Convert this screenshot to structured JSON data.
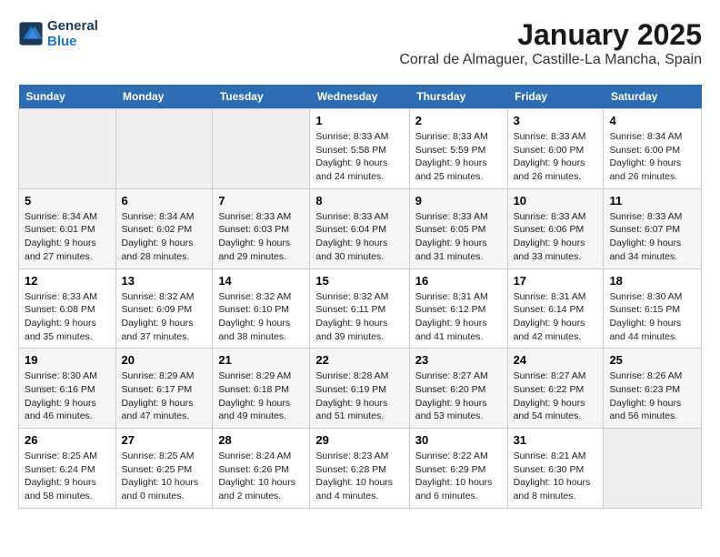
{
  "header": {
    "logo_line1": "General",
    "logo_line2": "Blue",
    "title": "January 2025",
    "subtitle": "Corral de Almaguer, Castille-La Mancha, Spain"
  },
  "columns": [
    "Sunday",
    "Monday",
    "Tuesday",
    "Wednesday",
    "Thursday",
    "Friday",
    "Saturday"
  ],
  "weeks": [
    [
      {
        "day": "",
        "empty": true
      },
      {
        "day": "",
        "empty": true
      },
      {
        "day": "",
        "empty": true
      },
      {
        "day": "1",
        "info": "Sunrise: 8:33 AM\nSunset: 5:58 PM\nDaylight: 9 hours and 24 minutes."
      },
      {
        "day": "2",
        "info": "Sunrise: 8:33 AM\nSunset: 5:59 PM\nDaylight: 9 hours and 25 minutes."
      },
      {
        "day": "3",
        "info": "Sunrise: 8:33 AM\nSunset: 6:00 PM\nDaylight: 9 hours and 26 minutes."
      },
      {
        "day": "4",
        "info": "Sunrise: 8:34 AM\nSunset: 6:00 PM\nDaylight: 9 hours and 26 minutes."
      }
    ],
    [
      {
        "day": "5",
        "info": "Sunrise: 8:34 AM\nSunset: 6:01 PM\nDaylight: 9 hours and 27 minutes."
      },
      {
        "day": "6",
        "info": "Sunrise: 8:34 AM\nSunset: 6:02 PM\nDaylight: 9 hours and 28 minutes."
      },
      {
        "day": "7",
        "info": "Sunrise: 8:33 AM\nSunset: 6:03 PM\nDaylight: 9 hours and 29 minutes."
      },
      {
        "day": "8",
        "info": "Sunrise: 8:33 AM\nSunset: 6:04 PM\nDaylight: 9 hours and 30 minutes."
      },
      {
        "day": "9",
        "info": "Sunrise: 8:33 AM\nSunset: 6:05 PM\nDaylight: 9 hours and 31 minutes."
      },
      {
        "day": "10",
        "info": "Sunrise: 8:33 AM\nSunset: 6:06 PM\nDaylight: 9 hours and 33 minutes."
      },
      {
        "day": "11",
        "info": "Sunrise: 8:33 AM\nSunset: 6:07 PM\nDaylight: 9 hours and 34 minutes."
      }
    ],
    [
      {
        "day": "12",
        "info": "Sunrise: 8:33 AM\nSunset: 6:08 PM\nDaylight: 9 hours and 35 minutes."
      },
      {
        "day": "13",
        "info": "Sunrise: 8:32 AM\nSunset: 6:09 PM\nDaylight: 9 hours and 37 minutes."
      },
      {
        "day": "14",
        "info": "Sunrise: 8:32 AM\nSunset: 6:10 PM\nDaylight: 9 hours and 38 minutes."
      },
      {
        "day": "15",
        "info": "Sunrise: 8:32 AM\nSunset: 6:11 PM\nDaylight: 9 hours and 39 minutes."
      },
      {
        "day": "16",
        "info": "Sunrise: 8:31 AM\nSunset: 6:12 PM\nDaylight: 9 hours and 41 minutes."
      },
      {
        "day": "17",
        "info": "Sunrise: 8:31 AM\nSunset: 6:14 PM\nDaylight: 9 hours and 42 minutes."
      },
      {
        "day": "18",
        "info": "Sunrise: 8:30 AM\nSunset: 6:15 PM\nDaylight: 9 hours and 44 minutes."
      }
    ],
    [
      {
        "day": "19",
        "info": "Sunrise: 8:30 AM\nSunset: 6:16 PM\nDaylight: 9 hours and 46 minutes."
      },
      {
        "day": "20",
        "info": "Sunrise: 8:29 AM\nSunset: 6:17 PM\nDaylight: 9 hours and 47 minutes."
      },
      {
        "day": "21",
        "info": "Sunrise: 8:29 AM\nSunset: 6:18 PM\nDaylight: 9 hours and 49 minutes."
      },
      {
        "day": "22",
        "info": "Sunrise: 8:28 AM\nSunset: 6:19 PM\nDaylight: 9 hours and 51 minutes."
      },
      {
        "day": "23",
        "info": "Sunrise: 8:27 AM\nSunset: 6:20 PM\nDaylight: 9 hours and 53 minutes."
      },
      {
        "day": "24",
        "info": "Sunrise: 8:27 AM\nSunset: 6:22 PM\nDaylight: 9 hours and 54 minutes."
      },
      {
        "day": "25",
        "info": "Sunrise: 8:26 AM\nSunset: 6:23 PM\nDaylight: 9 hours and 56 minutes."
      }
    ],
    [
      {
        "day": "26",
        "info": "Sunrise: 8:25 AM\nSunset: 6:24 PM\nDaylight: 9 hours and 58 minutes."
      },
      {
        "day": "27",
        "info": "Sunrise: 8:25 AM\nSunset: 6:25 PM\nDaylight: 10 hours and 0 minutes."
      },
      {
        "day": "28",
        "info": "Sunrise: 8:24 AM\nSunset: 6:26 PM\nDaylight: 10 hours and 2 minutes."
      },
      {
        "day": "29",
        "info": "Sunrise: 8:23 AM\nSunset: 6:28 PM\nDaylight: 10 hours and 4 minutes."
      },
      {
        "day": "30",
        "info": "Sunrise: 8:22 AM\nSunset: 6:29 PM\nDaylight: 10 hours and 6 minutes."
      },
      {
        "day": "31",
        "info": "Sunrise: 8:21 AM\nSunset: 6:30 PM\nDaylight: 10 hours and 8 minutes."
      },
      {
        "day": "",
        "empty": true
      }
    ]
  ]
}
